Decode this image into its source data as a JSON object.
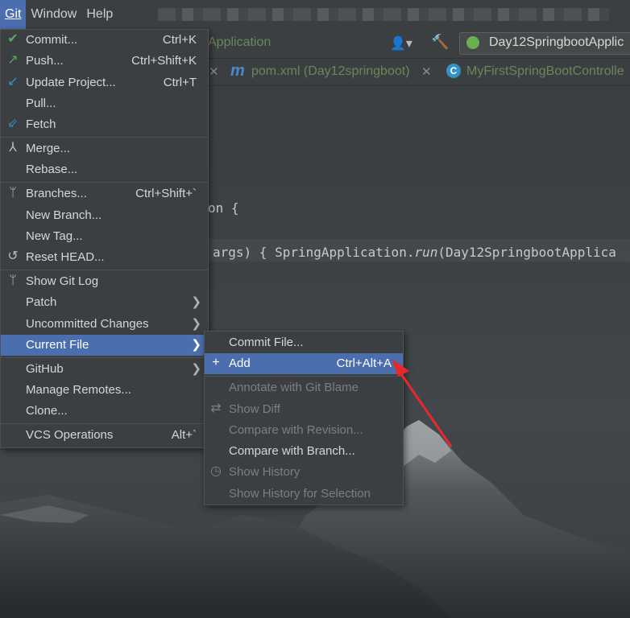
{
  "menubar": {
    "git": "Git",
    "window": "Window",
    "help": "Help"
  },
  "toolbar": {
    "run_config_label": "Application",
    "config_name": "Day12SpringbootApplic"
  },
  "tabs": [
    {
      "label": "pom.xml (Day12springboot)"
    },
    {
      "label": "MyFirstSpringBootControlle"
    }
  ],
  "code": {
    "line1": "on {",
    "line2_a": "args) { SpringApplication.",
    "line2_b": "run",
    "line2_c": "(Day12SpringbootApplica"
  },
  "git_menu": {
    "items": [
      {
        "label": "Commit...",
        "shortcut": "Ctrl+K",
        "icon": "check-icon"
      },
      {
        "label": "Push...",
        "shortcut": "Ctrl+Shift+K",
        "icon": "push-arrow-icon"
      },
      {
        "label": "Update Project...",
        "shortcut": "Ctrl+T",
        "icon": "update-arrow-icon"
      },
      {
        "label": "Pull...",
        "shortcut": ""
      },
      {
        "label": "Fetch",
        "shortcut": "",
        "icon": "fetch-icon"
      },
      {
        "label": "Merge...",
        "shortcut": "",
        "icon": "merge-icon"
      },
      {
        "label": "Rebase...",
        "shortcut": ""
      },
      {
        "label": "Branches...",
        "shortcut": "Ctrl+Shift+`",
        "icon": "branch-icon"
      },
      {
        "label": "New Branch...",
        "shortcut": ""
      },
      {
        "label": "New Tag...",
        "shortcut": ""
      },
      {
        "label": "Reset HEAD...",
        "shortcut": "",
        "icon": "reset-icon"
      },
      {
        "label": "Show Git Log",
        "shortcut": "",
        "icon": "branch-icon"
      },
      {
        "label": "Patch",
        "shortcut": ""
      },
      {
        "label": "Uncommitted Changes",
        "shortcut": ""
      },
      {
        "label": "Current File",
        "shortcut": ""
      },
      {
        "label": "GitHub",
        "shortcut": ""
      },
      {
        "label": "Manage Remotes...",
        "shortcut": ""
      },
      {
        "label": "Clone...",
        "shortcut": ""
      },
      {
        "label": "VCS Operations",
        "shortcut": "Alt+`"
      }
    ]
  },
  "current_file_menu": {
    "items": [
      {
        "label": "Commit File...",
        "shortcut": ""
      },
      {
        "label": "Add",
        "shortcut": "Ctrl+Alt+A",
        "icon": "plus-icon"
      },
      {
        "label": "Annotate with Git Blame",
        "shortcut": ""
      },
      {
        "label": "Show Diff",
        "shortcut": "",
        "icon": "diff-icon"
      },
      {
        "label": "Compare with Revision...",
        "shortcut": ""
      },
      {
        "label": "Compare with Branch...",
        "shortcut": ""
      },
      {
        "label": "Show History",
        "shortcut": "",
        "icon": "history-icon"
      },
      {
        "label": "Show History for Selection",
        "shortcut": ""
      }
    ]
  },
  "colors": {
    "selection": "#4b6eaf",
    "menu_bg": "#3c3f41",
    "annotation_arrow": "#e8282d"
  }
}
